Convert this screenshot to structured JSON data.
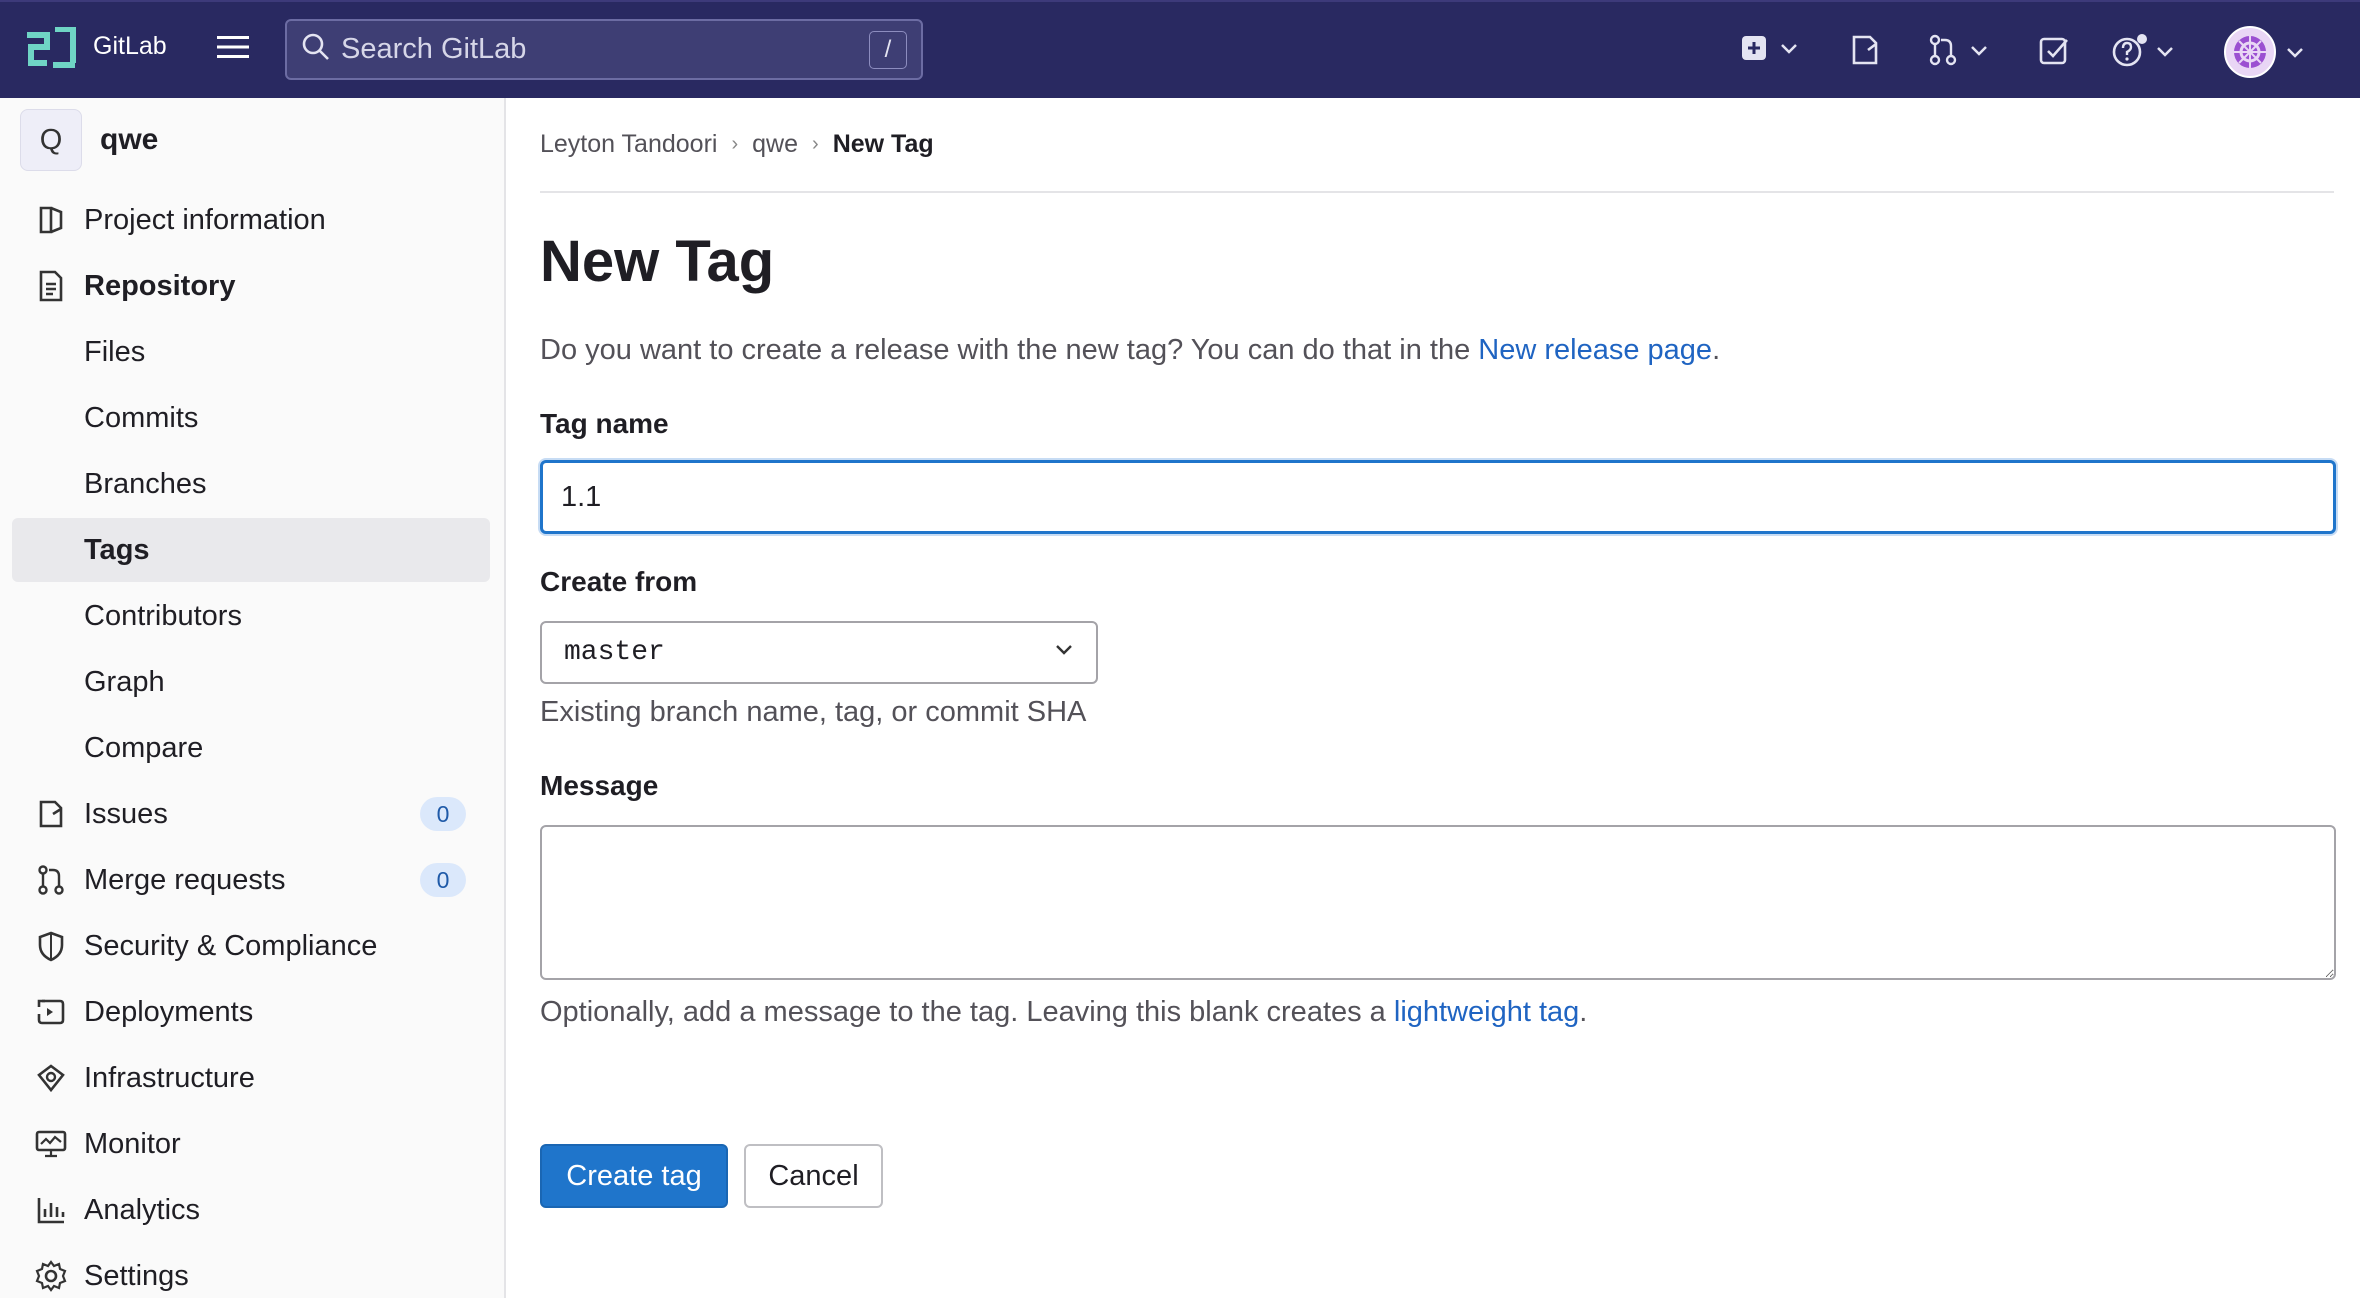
{
  "topbar": {
    "brand": "GitLab",
    "search_placeholder": "Search GitLab",
    "search_shortcut": "/",
    "icons": [
      "plus-square-icon",
      "issues-icon",
      "merge-request-icon",
      "todo-icon",
      "help-icon",
      "avatar"
    ]
  },
  "sidebar": {
    "project_initial": "Q",
    "project_name": "qwe",
    "items": [
      {
        "label": "Project information",
        "icon": "project-icon"
      },
      {
        "label": "Repository",
        "icon": "repository-icon"
      },
      {
        "label": "Files"
      },
      {
        "label": "Commits"
      },
      {
        "label": "Branches"
      },
      {
        "label": "Tags"
      },
      {
        "label": "Contributors"
      },
      {
        "label": "Graph"
      },
      {
        "label": "Compare"
      },
      {
        "label": "Issues",
        "icon": "issues-icon",
        "count": "0"
      },
      {
        "label": "Merge requests",
        "icon": "merge-request-icon",
        "count": "0"
      },
      {
        "label": "Security & Compliance",
        "icon": "shield-icon"
      },
      {
        "label": "Deployments",
        "icon": "deployments-icon"
      },
      {
        "label": "Infrastructure",
        "icon": "infrastructure-icon"
      },
      {
        "label": "Monitor",
        "icon": "monitor-icon"
      },
      {
        "label": "Analytics",
        "icon": "analytics-icon"
      },
      {
        "label": "Settings",
        "icon": "settings-icon"
      }
    ]
  },
  "breadcrumb": [
    "Leyton Tandoori",
    "qwe",
    "New Tag"
  ],
  "page": {
    "title": "New Tag",
    "intro_text": "Do you want to create a release with the new tag? You can do that in the ",
    "intro_link": "New release page",
    "intro_end": "."
  },
  "form": {
    "tag_name_label": "Tag name",
    "tag_name_value": "1.1",
    "create_from_label": "Create from",
    "create_from_value": "master",
    "create_from_help": "Existing branch name, tag, or commit SHA",
    "message_label": "Message",
    "message_value": "",
    "message_help_text": "Optionally, add a message to the tag. Leaving this blank creates a ",
    "message_help_link": "lightweight tag",
    "message_help_end": ".",
    "submit_label": "Create tag",
    "cancel_label": "Cancel"
  },
  "colors": {
    "topbar": "#292961",
    "primary": "#1f75cb",
    "link": "#1f64c2"
  }
}
